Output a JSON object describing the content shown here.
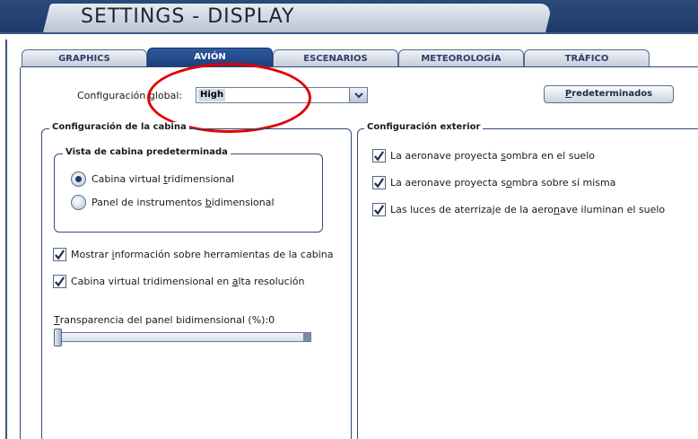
{
  "window": {
    "title": "SETTINGS - DISPLAY"
  },
  "tabs": [
    {
      "label": "GRAPHICS"
    },
    {
      "label": "AVIÓN"
    },
    {
      "label": "ESCENARIOS"
    },
    {
      "label": "METEOROLOGÍA"
    },
    {
      "label": "TRÁFICO"
    }
  ],
  "active_tab": "AVIÓN",
  "global_config": {
    "label_pre": "Configuración ",
    "label_u": "g",
    "label_post": "lobal:",
    "value": "High"
  },
  "defaults_button": {
    "label_u": "P",
    "label_rest": "redeterminados"
  },
  "cockpit_group": {
    "title": "Configuración de la cabina",
    "view_group": {
      "title": "Vista de cabina predeterminada",
      "options": [
        {
          "pre": "Cabina virtual ",
          "u": "t",
          "post": "ridimensional",
          "selected": true
        },
        {
          "pre": "Panel de instrumentos ",
          "u": "b",
          "post": "idimensional",
          "selected": false
        }
      ]
    },
    "checkboxes": [
      {
        "pre": "Mostrar ",
        "u": "i",
        "post": "nformación sobre herramientas de la cabina",
        "checked": true
      },
      {
        "pre": "Cabina virtual tridimensional en ",
        "u": "a",
        "post": "lta resolución",
        "checked": true
      }
    ],
    "transparency": {
      "u": "T",
      "label": "ransparencia del panel bidimensional (%): ",
      "value": "0",
      "level": 0
    }
  },
  "exterior_group": {
    "title": "Configuración exterior",
    "checkboxes": [
      {
        "pre": "La aeronave proyecta ",
        "u": "s",
        "post": "ombra en el suelo",
        "checked": true
      },
      {
        "pre": "La aeronave proyecta s",
        "u": "o",
        "post": "mbra sobre sí misma",
        "checked": true
      },
      {
        "pre": "Las luces de aterrizaje de la aero",
        "u": "n",
        "post": "ave iluminan el suelo",
        "checked": true
      }
    ]
  },
  "colors": {
    "accent": "#1c3e7c",
    "highlight": "#e00000"
  }
}
